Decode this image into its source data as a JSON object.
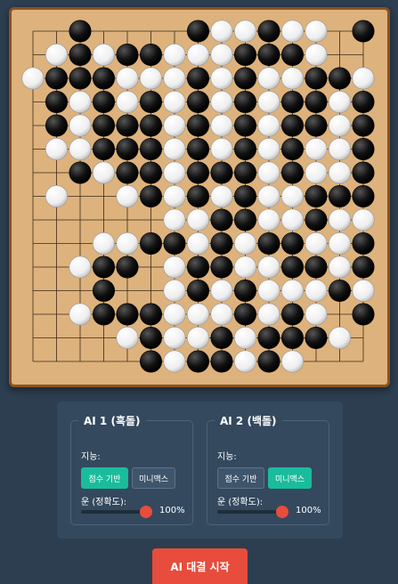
{
  "board": {
    "size": 15,
    "stones": [
      "..B....BWWBWW.B",
      ".WBWBBWWWBBBW..",
      "WBBBWWWBWBWWBBW",
      ".BWBWBWBWBWBBWB",
      ".BWBBBWBWBWBBWB",
      ".WWBBBWBWBWBWWB",
      "..BWBBWBBBWBWWB",
      ".W..WBWBWBWWBBB",
      "......WWBBWWBWW",
      "...WWBBWBWBBWWB",
      "..WBB.WBBWWBBWB",
      "...B..WBWBWWWBW",
      "..WBBBWWWBWBW.B",
      "....WBWWBWBBBW.",
      ".....BWBBWBW..."
    ]
  },
  "ai1": {
    "title": "AI 1 (흑돌)",
    "intelligence_label": "지능:",
    "option_score": "점수 기반",
    "option_minimax": "미니맥스",
    "selected": "score",
    "luck_label": "운 (정확도):",
    "luck_value": 100,
    "luck_text": "100%"
  },
  "ai2": {
    "title": "AI 2 (백돌)",
    "intelligence_label": "지능:",
    "option_score": "점수 기반",
    "option_minimax": "미니맥스",
    "selected": "minimax",
    "luck_label": "운 (정확도):",
    "luck_value": 100,
    "luck_text": "100%"
  },
  "start_button": "AI 대결 시작",
  "colors": {
    "accent": "#1abc9c",
    "start": "#e74c3c",
    "board": "#ddb27d"
  }
}
